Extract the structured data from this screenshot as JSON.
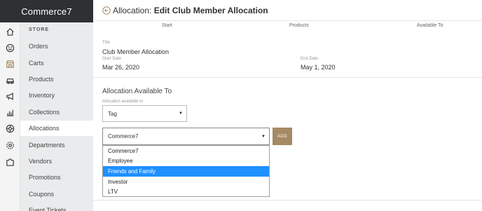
{
  "app": {
    "brand": "Commerce7"
  },
  "sidebar": {
    "heading": "STORE",
    "items": [
      {
        "label": "Orders"
      },
      {
        "label": "Carts"
      },
      {
        "label": "Products"
      },
      {
        "label": "Inventory"
      },
      {
        "label": "Collections"
      },
      {
        "label": "Allocations",
        "active": true
      },
      {
        "label": "Departments"
      },
      {
        "label": "Vendors"
      },
      {
        "label": "Promotions"
      },
      {
        "label": "Coupons"
      },
      {
        "label": "Event Tickets"
      }
    ],
    "rail_icons": [
      "home-icon",
      "smile-icon",
      "store-icon",
      "car-icon",
      "megaphone-icon",
      "bar-chart-icon",
      "aperture-icon",
      "settings-icon",
      "puzzle-icon"
    ]
  },
  "header": {
    "prefix": "Allocation:",
    "title": "Edit Club Member Allocation"
  },
  "steps": {
    "start": "Start",
    "products": "Products",
    "available_to": "Available To"
  },
  "details": {
    "title_label": "Title",
    "title_value": "Club Member Allocation",
    "start_label": "Start Date",
    "start_value": "Mar 26, 2020",
    "end_label": "End Date",
    "end_value": "May 1, 2020"
  },
  "availability": {
    "section_title": "Allocation Available To",
    "field_label": "Allocation available to",
    "type_select": "Tag",
    "tag_select": "Commerce7",
    "add_label": "ADD",
    "options": [
      "Commerce7",
      "Employee",
      "Friends and Family",
      "Investor",
      "LTV"
    ],
    "highlighted_option": "Friends and Family"
  },
  "colors": {
    "sidebar_dark": "#2e3133",
    "accent": "#a48a65",
    "highlight": "#1e90ff"
  }
}
